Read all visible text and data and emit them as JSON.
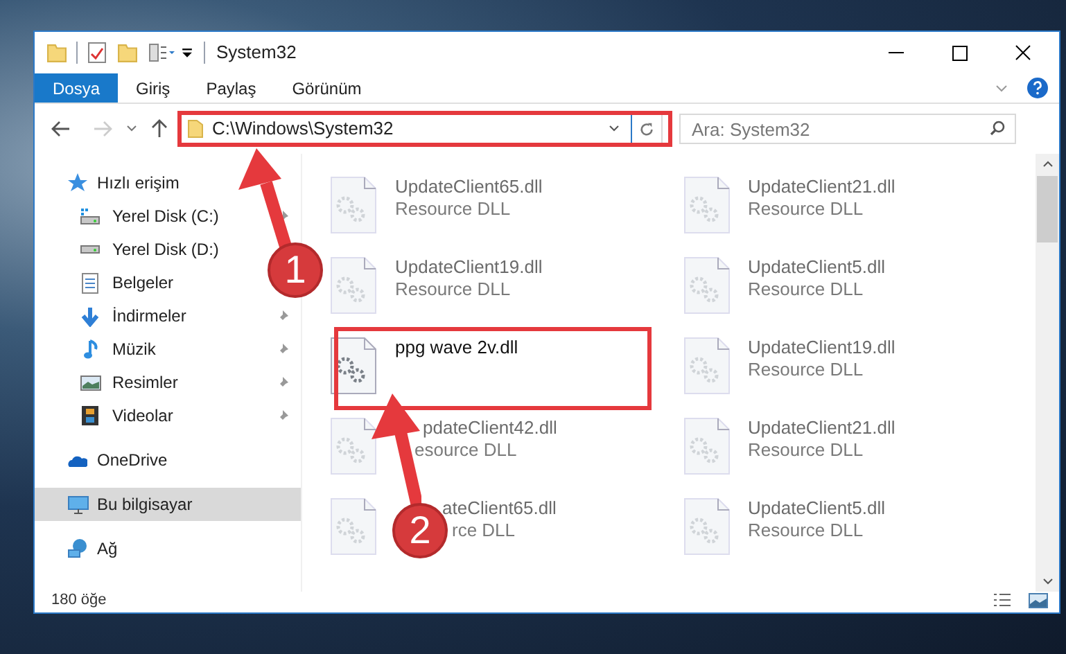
{
  "window": {
    "title": "System32"
  },
  "ribbon_tabs": [
    {
      "label": "Dosya",
      "selected": true
    },
    {
      "label": "Giriş",
      "selected": false
    },
    {
      "label": "Paylaş",
      "selected": false
    },
    {
      "label": "Görünüm",
      "selected": false
    }
  ],
  "address_bar": {
    "path": "C:\\Windows\\System32"
  },
  "search": {
    "placeholder": "Ara: System32"
  },
  "sidebar": {
    "items": [
      {
        "label": "Hızlı erişim",
        "kind": "star",
        "selected": false,
        "children": [
          {
            "label": "Yerel Disk (C:)",
            "kind": "drive-c",
            "pinned": true
          },
          {
            "label": "Yerel Disk (D:)",
            "kind": "drive"
          },
          {
            "label": "Belgeler",
            "kind": "document"
          },
          {
            "label": "İndirmeler",
            "kind": "download",
            "pinned": true
          },
          {
            "label": "Müzik",
            "kind": "music",
            "pinned": true
          },
          {
            "label": "Resimler",
            "kind": "pictures",
            "pinned": true
          },
          {
            "label": "Videolar",
            "kind": "video",
            "pinned": true
          }
        ]
      },
      {
        "label": "OneDrive",
        "kind": "cloud",
        "selected": false
      },
      {
        "label": "Bu bilgisayar",
        "kind": "computer",
        "selected": true
      },
      {
        "label": "Ağ",
        "kind": "network",
        "selected": false
      }
    ]
  },
  "files": [
    {
      "name": "UpdateClient65.dll",
      "type": "Resource DLL",
      "dimmed": true
    },
    {
      "name": "UpdateClient21.dll",
      "type": "Resource DLL",
      "dimmed": true
    },
    {
      "name": "UpdateClient19.dll",
      "type": "Resource DLL",
      "dimmed": true
    },
    {
      "name": "UpdateClient5.dll",
      "type": "Resource DLL",
      "dimmed": true
    },
    {
      "name": "ppg wave 2v.dll",
      "dimmed": false
    },
    {
      "name": "UpdateClient19.dll",
      "type": "Resource DLL",
      "dimmed": true
    },
    {
      "name": "pdateClient42.dll",
      "type": "esource DLL",
      "dimmed": true
    },
    {
      "name": "UpdateClient21.dll",
      "type": "Resource DLL",
      "dimmed": true
    },
    {
      "name": "ateClient65.dll",
      "type": "rce DLL",
      "dimmed": true
    },
    {
      "name": "UpdateClient5.dll",
      "type": "Resource DLL",
      "dimmed": true
    }
  ],
  "annotations": [
    {
      "number": "1"
    },
    {
      "number": "2"
    }
  ],
  "status_bar": {
    "count": "180 öğe"
  }
}
